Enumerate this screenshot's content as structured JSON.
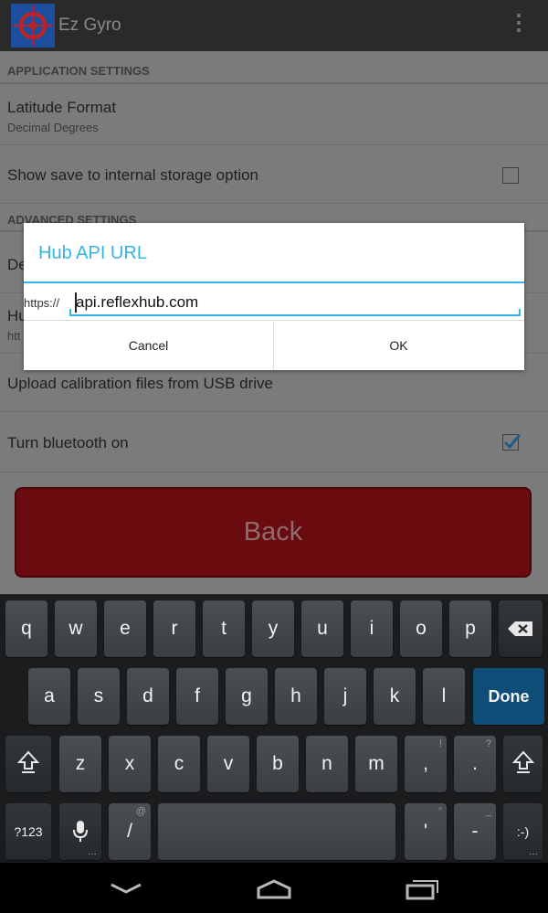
{
  "app": {
    "title": "Ez Gyro"
  },
  "settings": {
    "application_header": "APPLICATION SETTINGS",
    "latitude_title": "Latitude Format",
    "latitude_summary": "Decimal Degrees",
    "save_storage_title": "Show save to internal storage option",
    "save_storage_checked": false,
    "advanced_header": "ADVANCED SETTINGS",
    "partial_de": "De",
    "partial_hu": "Hu",
    "partial_htt": "htt",
    "usb_upload_title": "Upload calibration files from USB drive",
    "bluetooth_title": "Turn bluetooth on",
    "bluetooth_checked": true,
    "back_label": "Back"
  },
  "dialog": {
    "title": "Hub API URL",
    "prefix": "https://",
    "input_value": "api.reflexhub.com",
    "cancel_label": "Cancel",
    "ok_label": "OK"
  },
  "keyboard": {
    "row1": [
      "q",
      "w",
      "e",
      "r",
      "t",
      "y",
      "u",
      "i",
      "o",
      "p"
    ],
    "row2": [
      "a",
      "s",
      "d",
      "f",
      "g",
      "h",
      "j",
      "k",
      "l"
    ],
    "row3": [
      "z",
      "x",
      "c",
      "v",
      "b",
      "n",
      "m"
    ],
    "comma": ",",
    "comma_hint": "!",
    "period": ".",
    "period_hint": "?",
    "done_label": "Done",
    "symbols_label": "?123",
    "slash": "/",
    "slash_hint": "@",
    "apostrophe": "'",
    "apostrophe_hint": "\"",
    "dash": "-",
    "dash_hint": "_",
    "emoticon": ":-)",
    "accent_color": "#0e4d77"
  },
  "colors": {
    "holo_blue": "#33b5e5",
    "back_button": "#6a0b10"
  }
}
